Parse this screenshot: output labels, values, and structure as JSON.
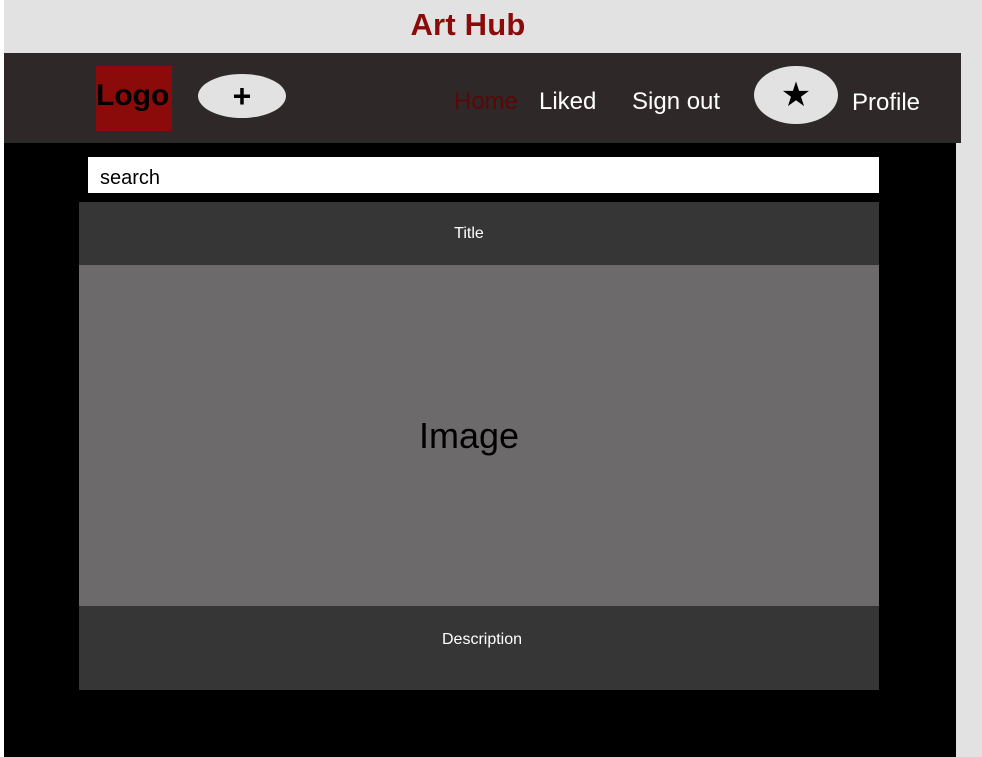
{
  "app": {
    "title": "Art Hub"
  },
  "navbar": {
    "logo": "Logo",
    "add_button": "+",
    "links": [
      "Home",
      "Liked",
      "Sign out"
    ],
    "star_button": "★",
    "profile": "Profile"
  },
  "search": {
    "value": "search"
  },
  "card": {
    "title": "Title",
    "image": "Image",
    "description": "Description"
  },
  "colors": {
    "brand": "#8b0a0a",
    "active_link": "#5a0707",
    "navbar_bg": "#2e2828",
    "content_bg": "#000000",
    "card_header_bg": "#363636",
    "image_bg": "#6c6a6a"
  }
}
